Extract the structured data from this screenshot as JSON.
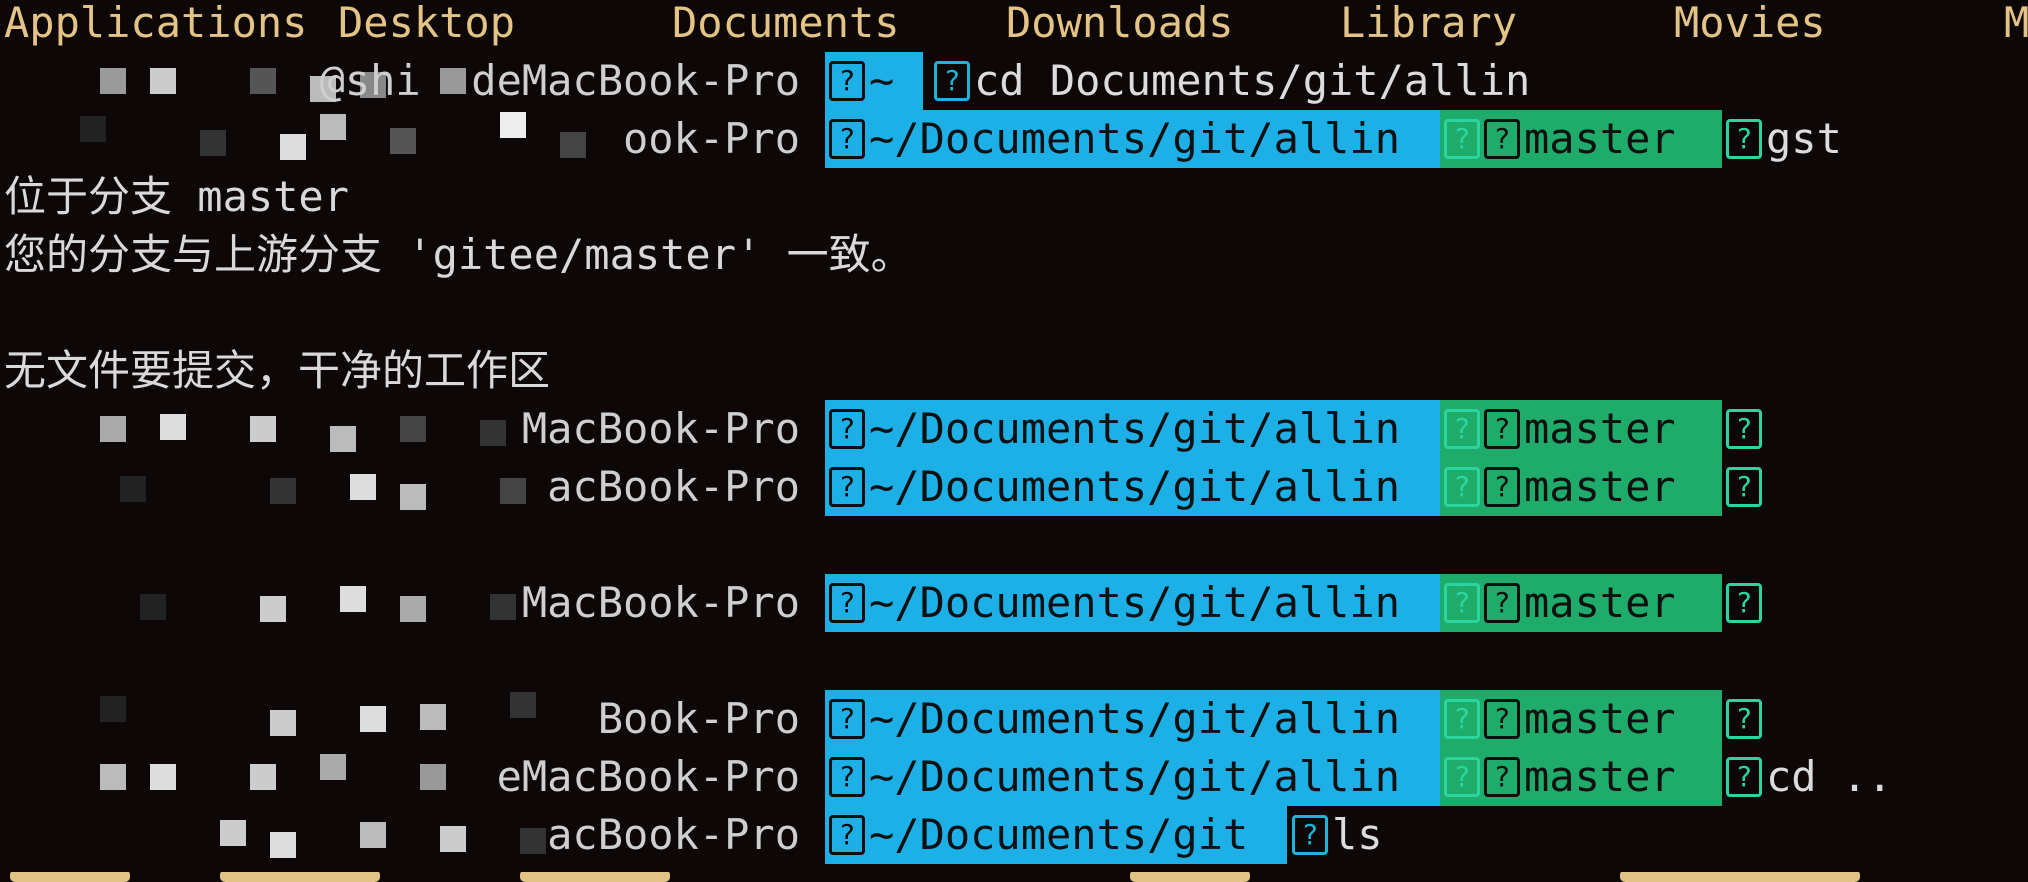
{
  "listing": [
    "Applications",
    "Desktop",
    "Documents",
    "Downloads",
    "Library",
    "Movies",
    "M"
  ],
  "host": "MacBook-Pro",
  "branch": "master",
  "paths": {
    "home": "~",
    "allin": "~/Documents/git/allin",
    "git": "~/Documents/git"
  },
  "commands": {
    "cd_allin": "cd Documents/git/allin",
    "gst": "gst",
    "cd_up": "cd ..",
    "ls": "ls"
  },
  "output": {
    "on_branch": "位于分支 master",
    "up_to_date": "您的分支与上游分支 'gitee/master' 一致。",
    "clean": "无文件要提交，干净的工作区"
  },
  "prompt_user_fragments": {
    "l1": "@shi  deMacBook-Pro",
    "l2": "ook-Pro",
    "l7": "MacBook-Pro",
    "l8": "acBook-Pro",
    "l10": "MacBook-Pro",
    "l12": "Book-Pro",
    "l13": "eMacBook-Pro",
    "l14": "acBook-Pro"
  },
  "colors": {
    "background": "#0d0707",
    "dir_segment": "#1db0e6",
    "git_segment": "#1fac6a",
    "listing_text": "#e3c486"
  }
}
